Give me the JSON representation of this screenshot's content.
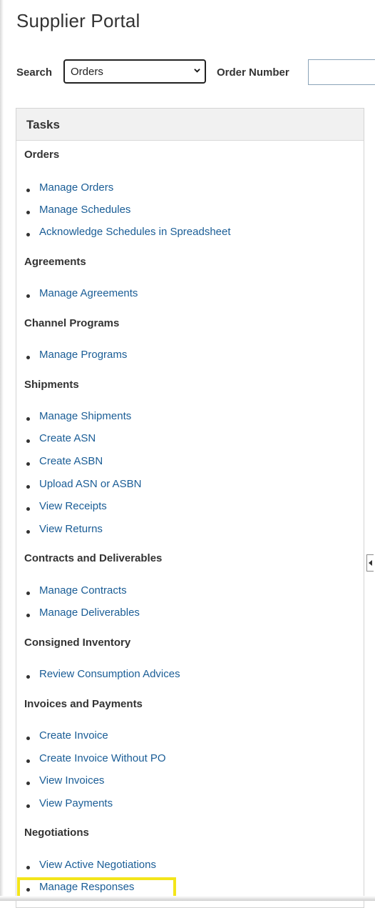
{
  "header": {
    "title": "Supplier Portal"
  },
  "search": {
    "label": "Search",
    "selected": "Orders",
    "order_label": "Order Number",
    "order_value": ""
  },
  "tasks": {
    "title": "Tasks",
    "sections": [
      {
        "heading": "Orders",
        "items": [
          "Manage Orders",
          "Manage Schedules",
          "Acknowledge Schedules in Spreadsheet"
        ]
      },
      {
        "heading": "Agreements",
        "items": [
          "Manage Agreements"
        ]
      },
      {
        "heading": "Channel Programs",
        "items": [
          "Manage Programs"
        ]
      },
      {
        "heading": "Shipments",
        "items": [
          "Manage Shipments",
          "Create ASN",
          "Create ASBN",
          "Upload ASN or ASBN",
          "View Receipts",
          "View Returns"
        ]
      },
      {
        "heading": "Contracts and Deliverables",
        "items": [
          "Manage Contracts",
          "Manage Deliverables"
        ]
      },
      {
        "heading": "Consigned Inventory",
        "items": [
          "Review Consumption Advices"
        ]
      },
      {
        "heading": "Invoices and Payments",
        "items": [
          "Create Invoice",
          "Create Invoice Without PO",
          "View Invoices",
          "View Payments"
        ]
      },
      {
        "heading": "Negotiations",
        "items": [
          "View Active Negotiations",
          "Manage Responses"
        ]
      }
    ]
  },
  "colors": {
    "link": "#1a5d96",
    "highlight": "#f3e51a",
    "header_bg": "#f1f1f1"
  }
}
